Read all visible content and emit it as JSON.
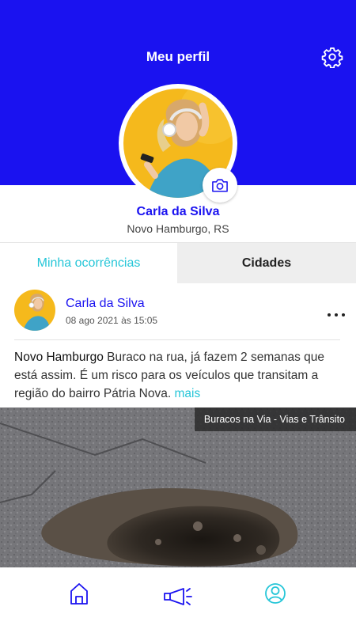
{
  "header": {
    "title": "Meu perfil",
    "settings_icon": "gear-icon"
  },
  "profile": {
    "name": "Carla da Silva",
    "city": "Novo Hamburgo, RS",
    "camera_icon": "camera-icon"
  },
  "tabs": [
    {
      "label": "Minha ocorrências",
      "active": true
    },
    {
      "label": "Cidades",
      "active": false
    }
  ],
  "post": {
    "author": "Carla da Silva",
    "date": "08 ago 2021 às 15:05",
    "city": "Novo Hamburgo",
    "text": " Buraco na rua, já fazem 2 semanas que está assim. É um risco para os veículos que transitam a região do bairro Pátria Nova.",
    "more": "mais",
    "category": "Buracos na Via - Vias e Trânsito"
  },
  "bottom_nav": [
    {
      "icon": "home-icon"
    },
    {
      "icon": "megaphone-icon"
    },
    {
      "icon": "user-icon",
      "active": true
    }
  ],
  "colors": {
    "brand": "#1a12f0",
    "accent": "#26c6d8",
    "inactive_tab_bg": "#eeeeee"
  }
}
